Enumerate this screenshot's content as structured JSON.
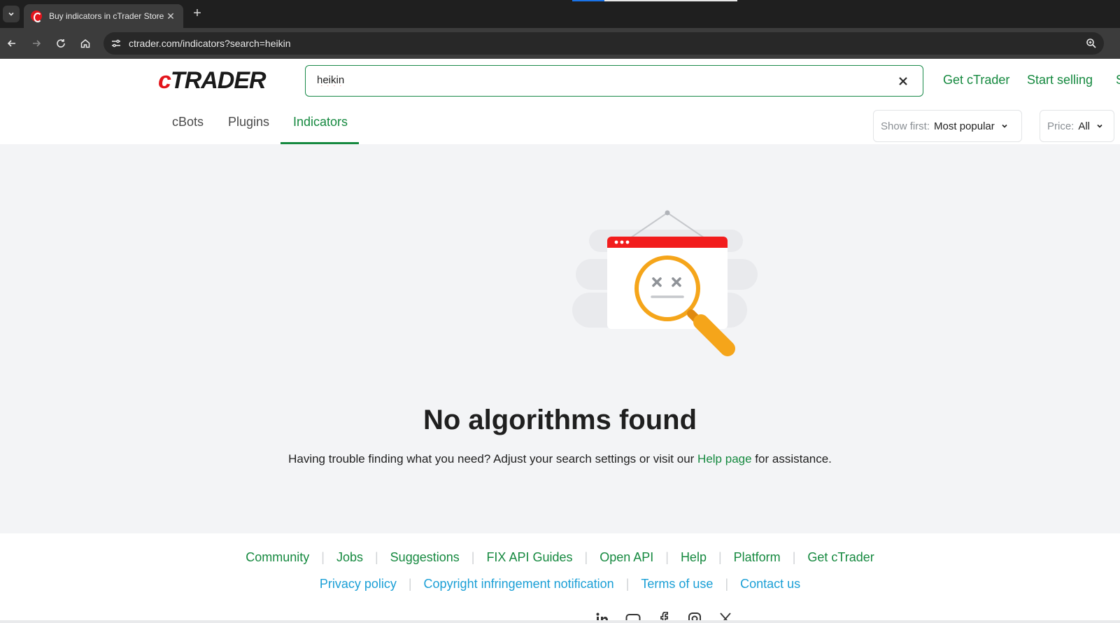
{
  "browser": {
    "tab_title": "Buy indicators in cTrader Store",
    "url": "ctrader.com/indicators?search=heikin"
  },
  "header": {
    "logo_c": "c",
    "logo_rest": "TRADER",
    "search_value": "heikin",
    "links": [
      "Get cTrader",
      "Start selling",
      "S"
    ]
  },
  "tabs": [
    "cBots",
    "Plugins",
    "Indicators"
  ],
  "active_tab": "Indicators",
  "filters": {
    "sort_label": "Show first:",
    "sort_value": "Most popular",
    "price_label": "Price:",
    "price_value": "All"
  },
  "empty_state": {
    "title": "No algorithms found",
    "message_before": "Having trouble finding what you need? Adjust your search settings or visit our",
    "help_link": "Help page",
    "message_after": "for assistance."
  },
  "footer": {
    "row1": [
      "Community",
      "Jobs",
      "Suggestions",
      "FIX API Guides",
      "Open API",
      "Help",
      "Platform",
      "Get cTrader"
    ],
    "row2": [
      "Privacy policy",
      "Copyright infringement notification",
      "Terms of use",
      "Contact us"
    ],
    "social_icons": [
      "linkedin-icon",
      "youtube-icon",
      "facebook-icon",
      "instagram-icon",
      "x-icon"
    ]
  },
  "colors": {
    "brand_green": "#15893f",
    "brand_red": "#e3141b",
    "link_blue": "#1a9fd6",
    "illustration_orange": "#f5a51a"
  }
}
